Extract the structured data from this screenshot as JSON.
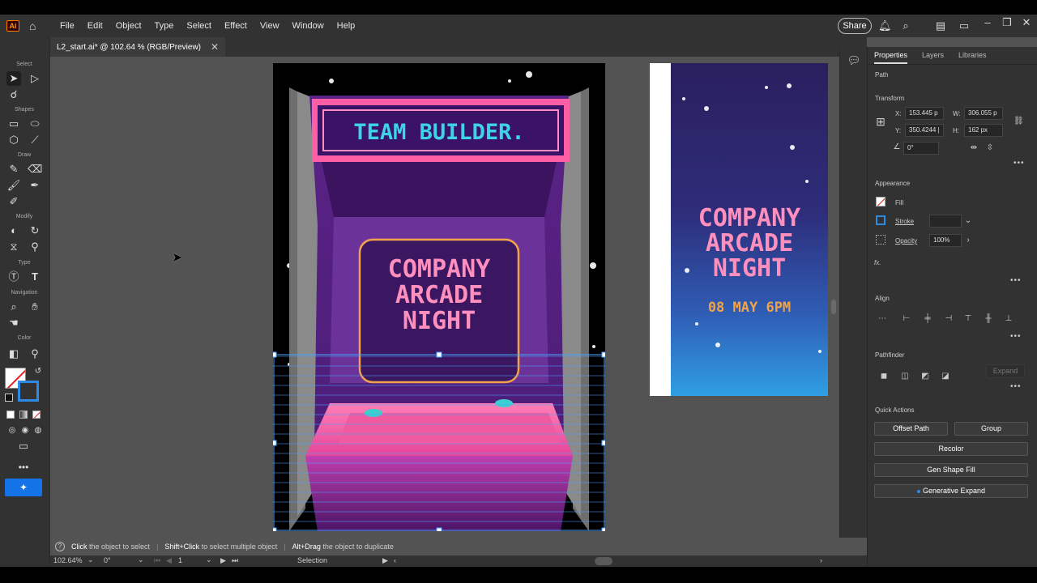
{
  "app": {
    "logo": "Ai",
    "menu": [
      "File",
      "Edit",
      "Object",
      "Type",
      "Select",
      "Effect",
      "View",
      "Window",
      "Help"
    ],
    "share_label": "Share",
    "doc_tab": "L2_start.ai* @ 102.64 % (RGB/Preview)"
  },
  "toolbar": {
    "sections": [
      "Select",
      "Shapes",
      "Draw",
      "Modify",
      "Type",
      "Navigation",
      "Color"
    ]
  },
  "artboard1": {
    "marquee": "TEAM BUILDER.",
    "screen_lines": [
      "COMPANY",
      "ARCADE",
      "NIGHT"
    ]
  },
  "artboard2": {
    "lines": [
      "COMPANY",
      "ARCADE",
      "NIGHT"
    ],
    "date": "08 MAY 6PM"
  },
  "properties": {
    "tabs": [
      "Properties",
      "Layers",
      "Libraries"
    ],
    "object_type": "Path",
    "transform_heading": "Transform",
    "x_label": "X:",
    "x_value": "153.445 p",
    "y_label": "Y:",
    "y_value": "350.4244 |",
    "w_label": "W:",
    "w_value": "306.055 p",
    "h_label": "H:",
    "h_value": "162 px",
    "angle_value": "0°",
    "appearance_heading": "Appearance",
    "fill_label": "Fill",
    "stroke_label": "Stroke",
    "opacity_label": "Opacity",
    "opacity_value": "100%",
    "fx_label": "fx.",
    "align_heading": "Align",
    "pathfinder_heading": "Pathfinder",
    "expand_label": "Expand",
    "quick_actions_heading": "Quick Actions",
    "offset_path": "Offset Path",
    "group": "Group",
    "recolor": "Recolor",
    "gen_shape_fill": "Gen Shape Fill",
    "generative_expand": "Generative Expand"
  },
  "status": {
    "hint_click": "Click",
    "hint_click_text": "the object to select",
    "hint_shift": "Shift+Click",
    "hint_shift_text": "to select multiple object",
    "hint_alt": "Alt+Drag",
    "hint_alt_text": "the object to duplicate",
    "zoom": "102.64%",
    "rotation": "0°",
    "artboard_num": "1",
    "tool_name": "Selection"
  },
  "colors": {
    "panel_bg": "#323232",
    "canvas_bg": "#535353",
    "selection_blue": "#4aa3ff",
    "neon_pink": "#ff6fa8",
    "neon_cyan": "#3ed3e6"
  }
}
